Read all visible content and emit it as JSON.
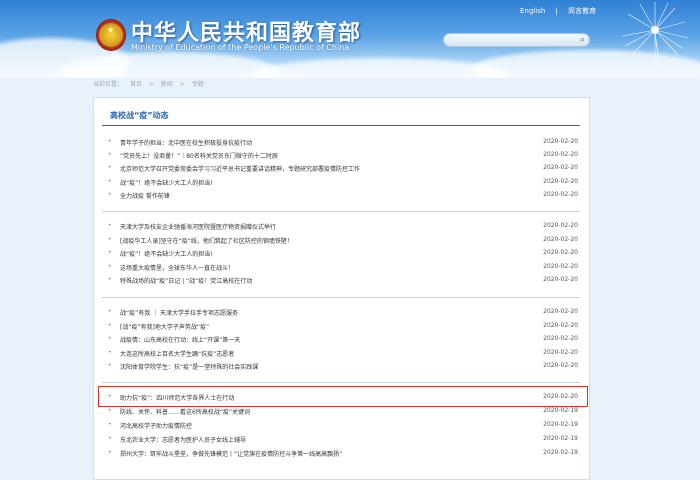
{
  "header": {
    "title_cn": "中华人民共和国教育部",
    "title_en": "Ministry of Education of the People's Republic of China",
    "links": [
      "English",
      "|",
      "简言教育"
    ],
    "icons": {
      "emblem": "national-emblem-icon",
      "search": "search-icon"
    }
  },
  "breadcrumb": [
    "当前位置：",
    "首页",
    ">",
    "新闻",
    ">",
    "专题"
  ],
  "section": {
    "title": "高校战“疫”动态"
  },
  "groups": [
    [
      {
        "title": "青年学子的担当：北中医在校生积极投身抗疫行动",
        "date": "2020-02-20"
      },
      {
        "title": "“党员先上！没商量！”｜80名科关党员东门微守的十二时辰",
        "date": "2020-02-20"
      },
      {
        "title": "北京师范大学召开党委常委会学习习近平总书记重要讲话精神，专题研究部署疫情防控工作",
        "date": "2020-02-20"
      },
      {
        "title": "战“疫”！绝不会缺少大工人的担当!",
        "date": "2020-02-20"
      },
      {
        "title": "全力战疫 誓作前锋",
        "date": "2020-02-20"
      }
    ],
    [
      {
        "title": "天津大学及校友企业驰援海河医院暨医疗物资捐赠仪式举行",
        "date": "2020-02-20"
      },
      {
        "title": "[战疫华工人录]坚守在“疫”线，他们筑起了社区防控的钢墙铁壁！",
        "date": "2020-02-20"
      },
      {
        "title": "战“疫”！绝不会缺少大工人的担当!",
        "date": "2020-02-20"
      },
      {
        "title": "这场重大疫情里，全球东华人一直在战斗！",
        "date": "2020-02-20"
      },
      {
        "title": "特殊战场的战“疫”日记 | “战”疫！党江高校在行动",
        "date": "2020-02-20"
      }
    ],
    [
      {
        "title": "战“疫”有我 ｜ 天津大学手拉手专项志愿服务",
        "date": "2020-02-20"
      },
      {
        "title": "[战“疫”有我]地大学子声势战“疫”",
        "date": "2020-02-20"
      },
      {
        "title": "战疫情：山东高校在行动：线上“开课”第一天",
        "date": "2020-02-20"
      },
      {
        "title": "大连这所高校上百名大学生踊“抗疫”志愿者",
        "date": "2020-02-20"
      },
      {
        "title": "沈阳体育学院学生：抗“疫”是一堂特殊的社会实践课",
        "date": "2020-02-20"
      }
    ],
    [
      {
        "title": "助力抗“疫”：四川师范大学各界人士在行动",
        "date": "2020-02-20"
      },
      {
        "title": "防线、关怀、科普……看这6所高校战“疫”关键词",
        "date": "2020-02-19"
      },
      {
        "title": "河北高校学子助力疫情防控",
        "date": "2020-02-19"
      },
      {
        "title": "东北农业大学：志愿者为医护人员子女线上辅导",
        "date": "2020-02-19"
      },
      {
        "title": "郑州大学：筑牢战斗堡垒，争做先锋模范丨“让党旗在疫情防控斗争第一线高高飘扬”",
        "date": "2020-02-19"
      }
    ]
  ]
}
